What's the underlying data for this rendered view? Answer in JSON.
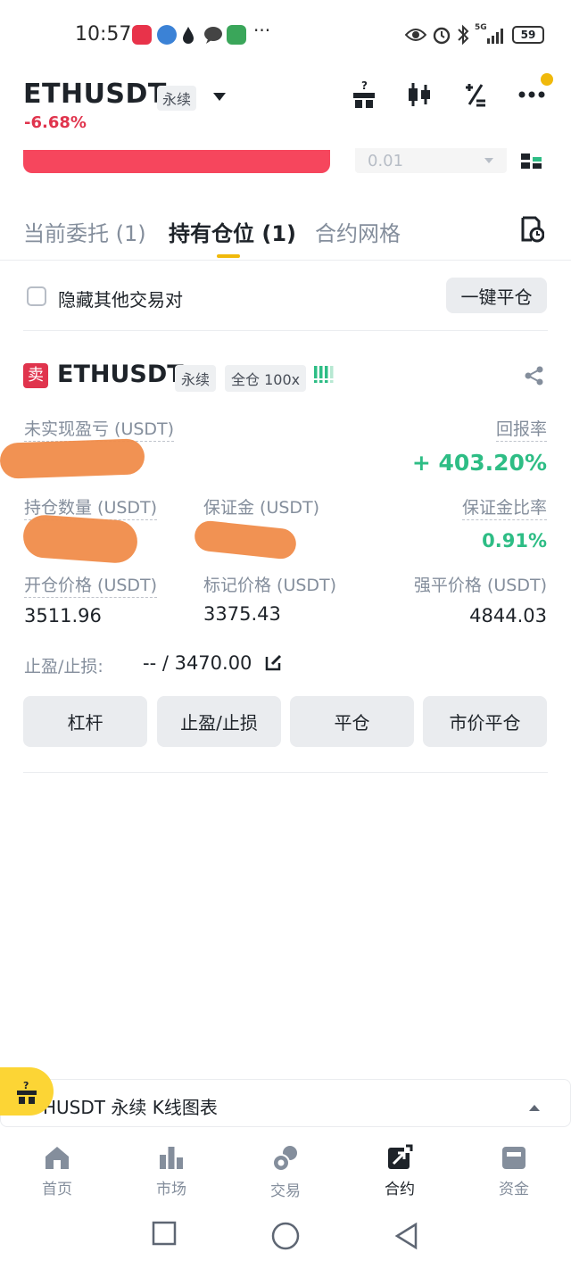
{
  "status_bar": {
    "time": "10:57",
    "ellipsis": "···",
    "battery": "59",
    "network": "5G"
  },
  "header": {
    "symbol": "ETHUSDT",
    "contract_type": "永续",
    "change": "-6.68%",
    "qty_value": "0.01"
  },
  "tabs": [
    {
      "label": "当前委托 (1)"
    },
    {
      "label": "持有仓位 (1)"
    },
    {
      "label": "合约网格"
    }
  ],
  "filter": {
    "hide_other_pairs": "隐藏其他交易对",
    "close_all": "一键平仓"
  },
  "position": {
    "side": "卖",
    "symbol": "ETHUSDT",
    "contract_type": "永续",
    "margin_mode": "全仓 100x",
    "unrealized_pnl_label": "未实现盈亏 (USDT)",
    "roe_label": "回报率",
    "roe_value": "+ 403.20%",
    "size_label": "持仓数量 (USDT)",
    "margin_label": "保证金 (USDT)",
    "margin_ratio_label": "保证金比率",
    "margin_ratio_value": "0.91%",
    "entry_price_label": "开仓价格 (USDT)",
    "entry_price": "3511.96",
    "mark_price_label": "标记价格 (USDT)",
    "mark_price": "3375.43",
    "liq_price_label": "强平价格 (USDT)",
    "liq_price": "4844.03",
    "tpsl_label": "止盈/止损:",
    "tpsl_value": "-- / 3470.00"
  },
  "actions": [
    {
      "label": "杠杆"
    },
    {
      "label": "止盈/止损"
    },
    {
      "label": "平仓"
    },
    {
      "label": "市价平仓"
    }
  ],
  "chart_bar": {
    "label": "HUSDT 永续 K线图表"
  },
  "bottom_nav": [
    {
      "label": "首页",
      "icon": "home-icon"
    },
    {
      "label": "市场",
      "icon": "bar-chart-icon"
    },
    {
      "label": "交易",
      "icon": "trade-icon"
    },
    {
      "label": "合约",
      "icon": "futures-icon",
      "active": true
    },
    {
      "label": "资金",
      "icon": "wallet-icon"
    }
  ],
  "colors": {
    "accent": "#f0b90b",
    "red": "#e0344d",
    "green": "#2ebd85"
  }
}
